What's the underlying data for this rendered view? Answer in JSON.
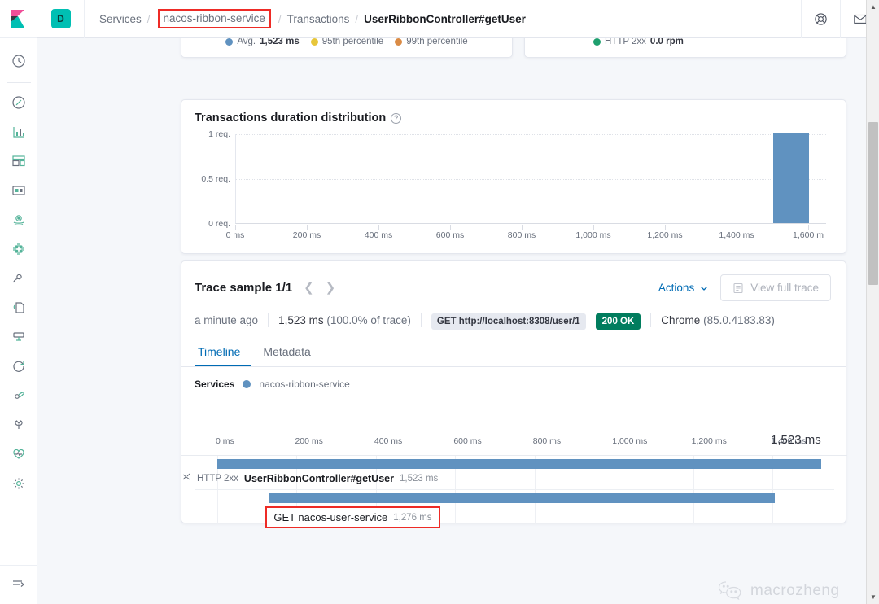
{
  "header": {
    "logo_icon": "kibana-logo-icon",
    "avatar_initial": "D",
    "breadcrumb": {
      "services": "Services",
      "service_name": "nacos-ribbon-service",
      "transactions": "Transactions",
      "current": "UserRibbonController#getUser",
      "separator": "/"
    },
    "help_icon": "lifesaver-help-icon",
    "mail_icon": "envelope-icon"
  },
  "leftnav": {
    "items": [
      {
        "icon": "recently-viewed-clock-icon",
        "label": "Recently viewed"
      },
      {
        "icon": "discover-compass-icon",
        "label": "Discover"
      },
      {
        "icon": "visualize-barchart-icon",
        "label": "Visualize"
      },
      {
        "icon": "dashboard-icon",
        "label": "Dashboard"
      },
      {
        "icon": "canvas-icon",
        "label": "Canvas"
      },
      {
        "icon": "maps-icon",
        "label": "Maps"
      },
      {
        "icon": "machine-learning-icon",
        "label": "Machine Learning"
      },
      {
        "icon": "infrastructure-icon",
        "label": "Infrastructure"
      },
      {
        "icon": "logs-icon",
        "label": "Logs"
      },
      {
        "icon": "apm-icon",
        "label": "APM"
      },
      {
        "icon": "uptime-icon",
        "label": "Uptime"
      },
      {
        "icon": "siem-icon",
        "label": "SIEM"
      },
      {
        "icon": "dev-tools-wrench-icon",
        "label": "Dev Tools"
      },
      {
        "icon": "monitoring-heart-icon",
        "label": "Monitoring"
      },
      {
        "icon": "management-gear-icon",
        "label": "Management"
      }
    ],
    "collapse_icon": "collapse-nav-icon",
    "collapse_label": "Collapse"
  },
  "clipped_panels": {
    "latency": {
      "legend": [
        {
          "label": "Avg.",
          "value": "1,523 ms",
          "color": "#6092c0"
        },
        {
          "label": "95th percentile",
          "value": "",
          "color": "#e7c63a"
        },
        {
          "label": "99th percentile",
          "value": "",
          "color": "#da8b45"
        }
      ]
    },
    "throughput": {
      "legend": [
        {
          "label": "HTTP 2xx",
          "value": "0.0 rpm",
          "color": "#1e9f6e"
        }
      ]
    }
  },
  "distribution": {
    "title": "Transactions duration distribution",
    "help_icon": "question-mark-icon"
  },
  "chart_data": {
    "type": "bar",
    "title": "Transactions duration distribution",
    "xlabel": "",
    "ylabel": "",
    "grid": true,
    "legend": "none",
    "x_ticks": [
      "0 ms",
      "200 ms",
      "400 ms",
      "600 ms",
      "800 ms",
      "1,000 ms",
      "1,200 ms",
      "1,400 ms",
      "1,600 m"
    ],
    "x_tick_values": [
      0,
      200,
      400,
      600,
      800,
      1000,
      1200,
      1400,
      1600
    ],
    "y_ticks": [
      "0 req.",
      "0.5 req.",
      "1 req."
    ],
    "y_tick_values": [
      0,
      0.5,
      1
    ],
    "xlim": [
      0,
      1650
    ],
    "ylim": [
      0,
      1
    ],
    "bar_color": "#6092c0",
    "bins": [
      {
        "x0": 1500,
        "x1": 1600,
        "value": 1
      }
    ]
  },
  "trace": {
    "title": "Trace sample 1/1",
    "prev_icon": "chevron-left-icon",
    "next_icon": "chevron-right-icon",
    "actions_label": "Actions",
    "actions_caret_icon": "chevron-down-icon",
    "view_full_trace_label": "View full trace",
    "view_full_trace_icon": "document-icon",
    "meta": {
      "timestamp": "a minute ago",
      "duration": "1,523 ms",
      "duration_pct": "(100.0% of trace)",
      "url_badge": "GET http://localhost:8308/user/1",
      "status_badge": "200 OK",
      "browser": "Chrome",
      "browser_version": "(85.0.4183.83)"
    },
    "tabs": [
      {
        "label": "Timeline",
        "active": true
      },
      {
        "label": "Metadata",
        "active": false
      }
    ],
    "services_label": "Services",
    "services": [
      {
        "name": "nacos-ribbon-service",
        "color": "#6092c0"
      }
    ],
    "timeline_ticks": [
      "0 ms",
      "200 ms",
      "400 ms",
      "600 ms",
      "800 ms",
      "1,000 ms",
      "1,200 ms",
      "1,400 ms"
    ],
    "timeline_total": "1,523 ms",
    "timeline_max_ms": 1523,
    "spans": [
      {
        "type": "HTTP 2xx",
        "type_icon": "transaction-icon",
        "name": "UserRibbonController#getUser",
        "duration": "1,523 ms",
        "start_ms": 0,
        "duration_ms": 1523,
        "color": "#6092c0",
        "highlighted": false,
        "indent": 0
      },
      {
        "type": "",
        "type_icon": "",
        "name": "GET nacos-user-service",
        "duration": "1,276 ms",
        "start_ms": 130,
        "duration_ms": 1276,
        "color": "#6092c0",
        "highlighted": true,
        "indent": 1
      }
    ]
  },
  "watermark": {
    "icon": "wechat-icon",
    "text": "macrozheng"
  },
  "scrollbar": {
    "up_icon": "scroll-up-arrow-icon",
    "down_icon": "scroll-down-arrow-icon"
  },
  "colors": {
    "accent_blue": "#006bb4",
    "bar_blue": "#6092c0",
    "success_green": "#017d5e",
    "brand_teal": "#00bfb3",
    "annotation_red": "#ee2b26"
  }
}
